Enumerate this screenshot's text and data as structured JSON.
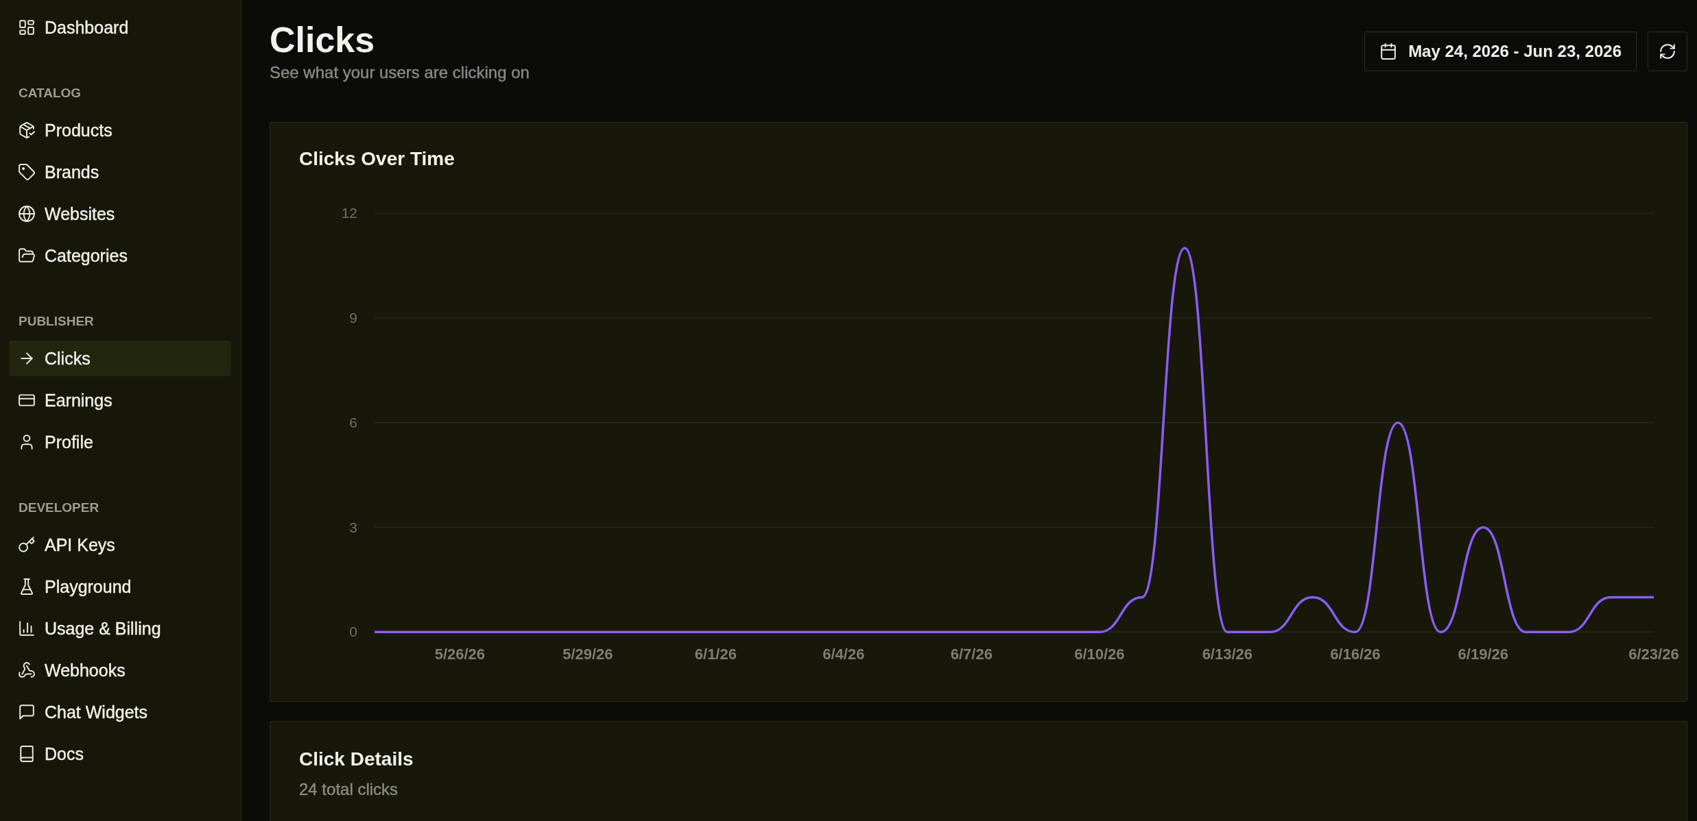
{
  "sidebar": {
    "sections": [
      {
        "items": [
          {
            "label": "Dashboard",
            "selected": false
          }
        ]
      },
      {
        "heading": "CATALOG",
        "items": [
          {
            "label": "Products",
            "selected": false
          },
          {
            "label": "Brands",
            "selected": false
          },
          {
            "label": "Websites",
            "selected": false
          },
          {
            "label": "Categories",
            "selected": false
          }
        ]
      },
      {
        "heading": "PUBLISHER",
        "items": [
          {
            "label": "Clicks",
            "selected": true
          },
          {
            "label": "Earnings",
            "selected": false
          },
          {
            "label": "Profile",
            "selected": false
          }
        ]
      },
      {
        "heading": "DEVELOPER",
        "items": [
          {
            "label": "API Keys",
            "selected": false
          },
          {
            "label": "Playground",
            "selected": false
          },
          {
            "label": "Usage & Billing",
            "selected": false
          },
          {
            "label": "Webhooks",
            "selected": false
          },
          {
            "label": "Chat Widgets",
            "selected": false
          },
          {
            "label": "Docs",
            "selected": false
          }
        ]
      }
    ]
  },
  "header": {
    "title": "Clicks",
    "subtitle": "See what your users are clicking on",
    "date_range": "May 24, 2026 - Jun 23, 2026"
  },
  "clicks_over_time": {
    "title": "Clicks Over Time",
    "chart_data": {
      "type": "line",
      "categories": [
        null,
        null,
        "5/26/26",
        null,
        null,
        "5/29/26",
        null,
        null,
        "6/1/26",
        null,
        null,
        "6/4/26",
        null,
        null,
        "6/7/26",
        null,
        null,
        "6/10/26",
        null,
        null,
        "6/13/26",
        null,
        null,
        "6/16/26",
        null,
        null,
        "6/19/26",
        null,
        null,
        null,
        "6/23/26"
      ],
      "values": [
        0,
        0,
        0,
        0,
        0,
        0,
        0,
        0,
        0,
        0,
        0,
        0,
        0,
        0,
        0,
        0,
        0,
        0,
        1,
        11,
        0,
        0,
        1,
        0,
        6,
        0,
        3,
        0,
        0,
        1,
        1
      ],
      "ylim": [
        0,
        12
      ],
      "yticks": [
        0,
        3,
        6,
        9,
        12
      ],
      "grid": true
    }
  },
  "click_details": {
    "title": "Click Details",
    "summary": "24 total clicks"
  }
}
